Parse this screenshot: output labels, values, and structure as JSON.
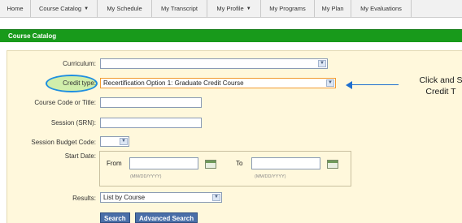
{
  "nav": {
    "items": [
      {
        "label": "Home"
      },
      {
        "label": "Course Catalog",
        "caret": "▼"
      },
      {
        "label": "My Schedule"
      },
      {
        "label": "My Transcript"
      },
      {
        "label": "My Profile",
        "caret": "▼"
      },
      {
        "label": "My Programs"
      },
      {
        "label": "My Plan"
      },
      {
        "label": "My Evaluations"
      }
    ]
  },
  "section": {
    "title": "Course Catalog"
  },
  "form": {
    "curriculum_label": "Curriculum:",
    "curriculum_value": "",
    "credit_type_label": "Credit type:",
    "credit_type_value": "Recertification Option 1: Graduate Credit Course",
    "course_code_label": "Course Code or Title:",
    "session_srn_label": "Session (SRN):",
    "budget_code_label": "Session Budget Code:",
    "start_date_label": "Start Date:",
    "from_label": "From",
    "to_label": "To",
    "date_hint": "(MM/DD/YYYY)",
    "results_label": "Results:",
    "results_value": "List by Course",
    "search_button": "Search",
    "advanced_search_button": "Advanced Search",
    "dropdown_glyph": "▼"
  },
  "callout": {
    "line1": "Click and S",
    "line2": "Credit T"
  },
  "colors": {
    "section_bar": "#189a1b",
    "form_bg": "#fff8dc",
    "highlight_oval": "#1f8fe0",
    "arrow": "#1f6fd0",
    "button": "#4a6fa8"
  }
}
